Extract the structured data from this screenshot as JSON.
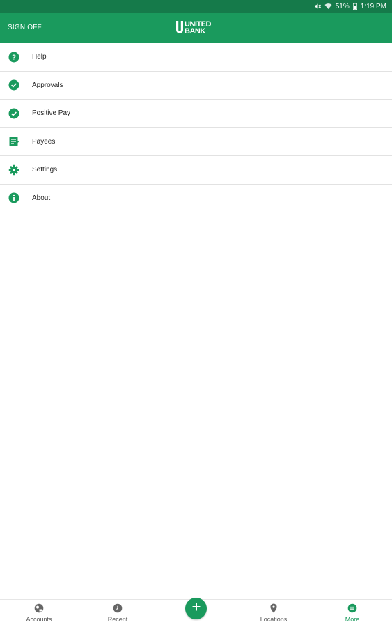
{
  "status_bar": {
    "battery": "51%",
    "time": "1:19 PM",
    "icons": [
      "mute-icon",
      "wifi-icon",
      "battery-icon"
    ]
  },
  "app_bar": {
    "sign_off": "SIGN OFF",
    "logo_line1": "UNITED",
    "logo_line2": "BANK"
  },
  "menu": {
    "items": [
      {
        "label": "Help",
        "icon": "help-icon"
      },
      {
        "label": "Approvals",
        "icon": "check-circle-icon"
      },
      {
        "label": "Positive Pay",
        "icon": "check-circle-icon"
      },
      {
        "label": "Payees",
        "icon": "payees-icon"
      },
      {
        "label": "Settings",
        "icon": "gear-icon"
      },
      {
        "label": "About",
        "icon": "info-icon"
      }
    ]
  },
  "bottom_nav": {
    "items": [
      {
        "label": "Accounts",
        "icon": "accounts-icon"
      },
      {
        "label": "Recent",
        "icon": "recent-icon"
      },
      {
        "label": "Locations",
        "icon": "location-pin-icon"
      },
      {
        "label": "More",
        "icon": "more-icon",
        "active": true
      }
    ],
    "fab_icon": "plus-icon"
  },
  "colors": {
    "status_bar": "#157a4a",
    "app_bar": "#1a9a5d",
    "accent": "#1a9a5d",
    "divider": "#e2e2e2"
  }
}
